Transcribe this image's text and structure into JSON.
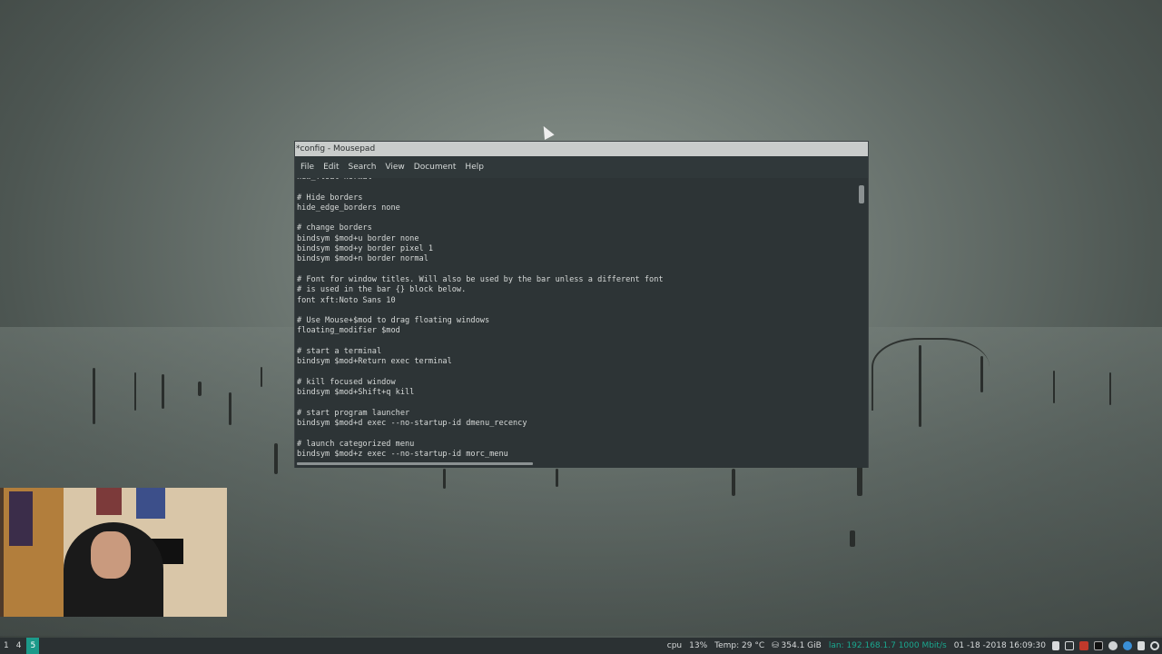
{
  "window": {
    "title": "*config - Mousepad",
    "menu": [
      "File",
      "Edit",
      "Search",
      "View",
      "Document",
      "Help"
    ]
  },
  "editor": {
    "lines": [
      "new_float normal",
      "",
      "# Hide borders",
      "hide_edge_borders none",
      "",
      "# change borders",
      "bindsym $mod+u border none",
      "bindsym $mod+y border pixel 1",
      "bindsym $mod+n border normal",
      "",
      "# Font for window titles. Will also be used by the bar unless a different font",
      "# is used in the bar {} block below.",
      "font xft:Noto Sans 10",
      "",
      "# Use Mouse+$mod to drag floating windows",
      "floating_modifier $mod",
      "",
      "# start a terminal",
      "bindsym $mod+Return exec terminal",
      "",
      "# kill focused window",
      "bindsym $mod+Shift+q kill",
      "",
      "# start program launcher",
      "bindsym $mod+d exec --no-startup-id dmenu_recency",
      "",
      "# launch categorized menu",
      "bindsym $mod+z exec --no-startup-id morc_menu"
    ]
  },
  "taskbar": {
    "workspaces": [
      "1",
      "4",
      "5"
    ],
    "active_workspace": "5",
    "cpu_label": "cpu",
    "cpu_value": "13%",
    "temp": "Temp: 29 °C",
    "disk": "⛁ 354.1 GiB",
    "lan": "lan: 192.168.1.7 1000 Mbit/s",
    "datetime": "01 -18 -2018 16:09:30",
    "tray_icons": [
      "clipboard-icon",
      "screen-icon",
      "pdf-icon",
      "terminal-icon",
      "gear-icon",
      "network-icon",
      "volume-icon",
      "power-icon"
    ]
  },
  "colors": {
    "accent": "#1c9a8a",
    "editor_bg": "#2d3436"
  }
}
